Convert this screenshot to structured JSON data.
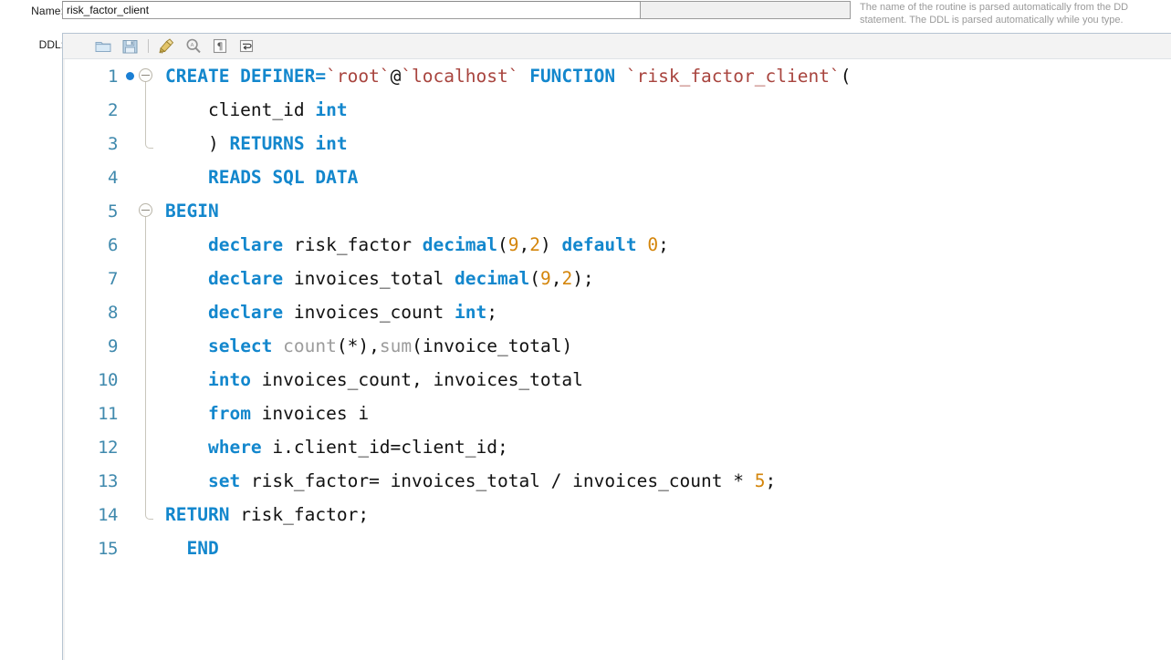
{
  "form": {
    "name_label": "Name:",
    "name_value": "risk_factor_client",
    "ddl_label": "DDL:"
  },
  "help": {
    "line1": "The name of the routine is parsed automatically from the DD",
    "line2": "statement. The DDL is parsed automatically while you type."
  },
  "toolbar": {
    "buttons": [
      {
        "name": "open-file-icon",
        "title": "Open File"
      },
      {
        "name": "save-file-icon",
        "title": "Save File"
      },
      {
        "name": "beautify-icon",
        "title": "Beautify Query"
      },
      {
        "name": "find-icon",
        "title": "Find"
      },
      {
        "name": "toggle-invisible-chars-icon",
        "title": "Toggle Invisible Characters"
      },
      {
        "name": "toggle-word-wrap-icon",
        "title": "Toggle Word Wrap"
      }
    ]
  },
  "colors": {
    "keyword": "#1387cd",
    "quoted_identifier": "#a8443e",
    "number": "#d4850a",
    "function": "#9c9c9c",
    "identifier": "#111111",
    "line_number": "#3f89ad",
    "breakpoint": "#1a7fd4",
    "toolbar_bg": "#f3f3f3",
    "panel_border": "#b6c4d2"
  },
  "editor": {
    "language": "sql",
    "lines": [
      {
        "number": "1",
        "breakpoint": true,
        "fold": "open-start",
        "tokens": [
          {
            "t": "CREATE DEFINER=",
            "c": "kw"
          },
          {
            "t": "`root`",
            "c": "qid"
          },
          {
            "t": "@",
            "c": "op"
          },
          {
            "t": "`localhost`",
            "c": "qid"
          },
          {
            "t": " ",
            "c": "ident"
          },
          {
            "t": "FUNCTION",
            "c": "kw"
          },
          {
            "t": " ",
            "c": "ident"
          },
          {
            "t": "`risk_factor_client`",
            "c": "qid"
          },
          {
            "t": "(",
            "c": "punc"
          }
        ]
      },
      {
        "number": "2",
        "breakpoint": false,
        "fold": "line",
        "tokens": [
          {
            "t": "    client_id ",
            "c": "ident"
          },
          {
            "t": "int",
            "c": "kw"
          }
        ]
      },
      {
        "number": "3",
        "breakpoint": false,
        "fold": "end",
        "tokens": [
          {
            "t": "    ) ",
            "c": "ident"
          },
          {
            "t": "RETURNS int",
            "c": "kw"
          }
        ]
      },
      {
        "number": "4",
        "breakpoint": false,
        "fold": "none",
        "tokens": [
          {
            "t": "    ",
            "c": "ident"
          },
          {
            "t": "READS SQL DATA",
            "c": "kw"
          }
        ]
      },
      {
        "number": "5",
        "breakpoint": false,
        "fold": "open-start",
        "tokens": [
          {
            "t": "BEGIN",
            "c": "kw"
          }
        ]
      },
      {
        "number": "6",
        "breakpoint": false,
        "fold": "line",
        "tokens": [
          {
            "t": "    ",
            "c": "ident"
          },
          {
            "t": "declare",
            "c": "kw"
          },
          {
            "t": " risk_factor ",
            "c": "ident"
          },
          {
            "t": "decimal",
            "c": "kw"
          },
          {
            "t": "(",
            "c": "punc"
          },
          {
            "t": "9",
            "c": "num"
          },
          {
            "t": ",",
            "c": "punc"
          },
          {
            "t": "2",
            "c": "num"
          },
          {
            "t": ") ",
            "c": "punc"
          },
          {
            "t": "default",
            "c": "kw"
          },
          {
            "t": " ",
            "c": "ident"
          },
          {
            "t": "0",
            "c": "num"
          },
          {
            "t": ";",
            "c": "punc"
          }
        ]
      },
      {
        "number": "7",
        "breakpoint": false,
        "fold": "line",
        "tokens": [
          {
            "t": "    ",
            "c": "ident"
          },
          {
            "t": "declare",
            "c": "kw"
          },
          {
            "t": " invoices_total ",
            "c": "ident"
          },
          {
            "t": "decimal",
            "c": "kw"
          },
          {
            "t": "(",
            "c": "punc"
          },
          {
            "t": "9",
            "c": "num"
          },
          {
            "t": ",",
            "c": "punc"
          },
          {
            "t": "2",
            "c": "num"
          },
          {
            "t": ");",
            "c": "punc"
          }
        ]
      },
      {
        "number": "8",
        "breakpoint": false,
        "fold": "line",
        "tokens": [
          {
            "t": "    ",
            "c": "ident"
          },
          {
            "t": "declare",
            "c": "kw"
          },
          {
            "t": " invoices_count ",
            "c": "ident"
          },
          {
            "t": "int",
            "c": "kw"
          },
          {
            "t": ";",
            "c": "punc"
          }
        ]
      },
      {
        "number": "9",
        "breakpoint": false,
        "fold": "line",
        "tokens": [
          {
            "t": "    ",
            "c": "ident"
          },
          {
            "t": "select",
            "c": "kw"
          },
          {
            "t": " ",
            "c": "ident"
          },
          {
            "t": "count",
            "c": "fn"
          },
          {
            "t": "(*),",
            "c": "punc"
          },
          {
            "t": "sum",
            "c": "fn"
          },
          {
            "t": "(invoice_total)",
            "c": "ident"
          }
        ]
      },
      {
        "number": "10",
        "breakpoint": false,
        "fold": "line",
        "tokens": [
          {
            "t": "    ",
            "c": "ident"
          },
          {
            "t": "into",
            "c": "kw"
          },
          {
            "t": " invoices_count, invoices_total",
            "c": "ident"
          }
        ]
      },
      {
        "number": "11",
        "breakpoint": false,
        "fold": "line",
        "tokens": [
          {
            "t": "    ",
            "c": "ident"
          },
          {
            "t": "from",
            "c": "kw"
          },
          {
            "t": " invoices i",
            "c": "ident"
          }
        ]
      },
      {
        "number": "12",
        "breakpoint": false,
        "fold": "line",
        "tokens": [
          {
            "t": "    ",
            "c": "ident"
          },
          {
            "t": "where",
            "c": "kw"
          },
          {
            "t": " i.client_id=client_id;",
            "c": "ident"
          }
        ]
      },
      {
        "number": "13",
        "breakpoint": false,
        "fold": "line",
        "tokens": [
          {
            "t": "    ",
            "c": "ident"
          },
          {
            "t": "set",
            "c": "kw"
          },
          {
            "t": " risk_factor= invoices_total / invoices_count * ",
            "c": "ident"
          },
          {
            "t": "5",
            "c": "num"
          },
          {
            "t": ";",
            "c": "punc"
          }
        ]
      },
      {
        "number": "14",
        "breakpoint": false,
        "fold": "end",
        "tokens": [
          {
            "t": "RETURN",
            "c": "kw"
          },
          {
            "t": " risk_factor;",
            "c": "ident"
          }
        ]
      },
      {
        "number": "15",
        "breakpoint": false,
        "fold": "none",
        "tokens": [
          {
            "t": "  ",
            "c": "ident"
          },
          {
            "t": "END",
            "c": "kw"
          }
        ]
      }
    ]
  }
}
